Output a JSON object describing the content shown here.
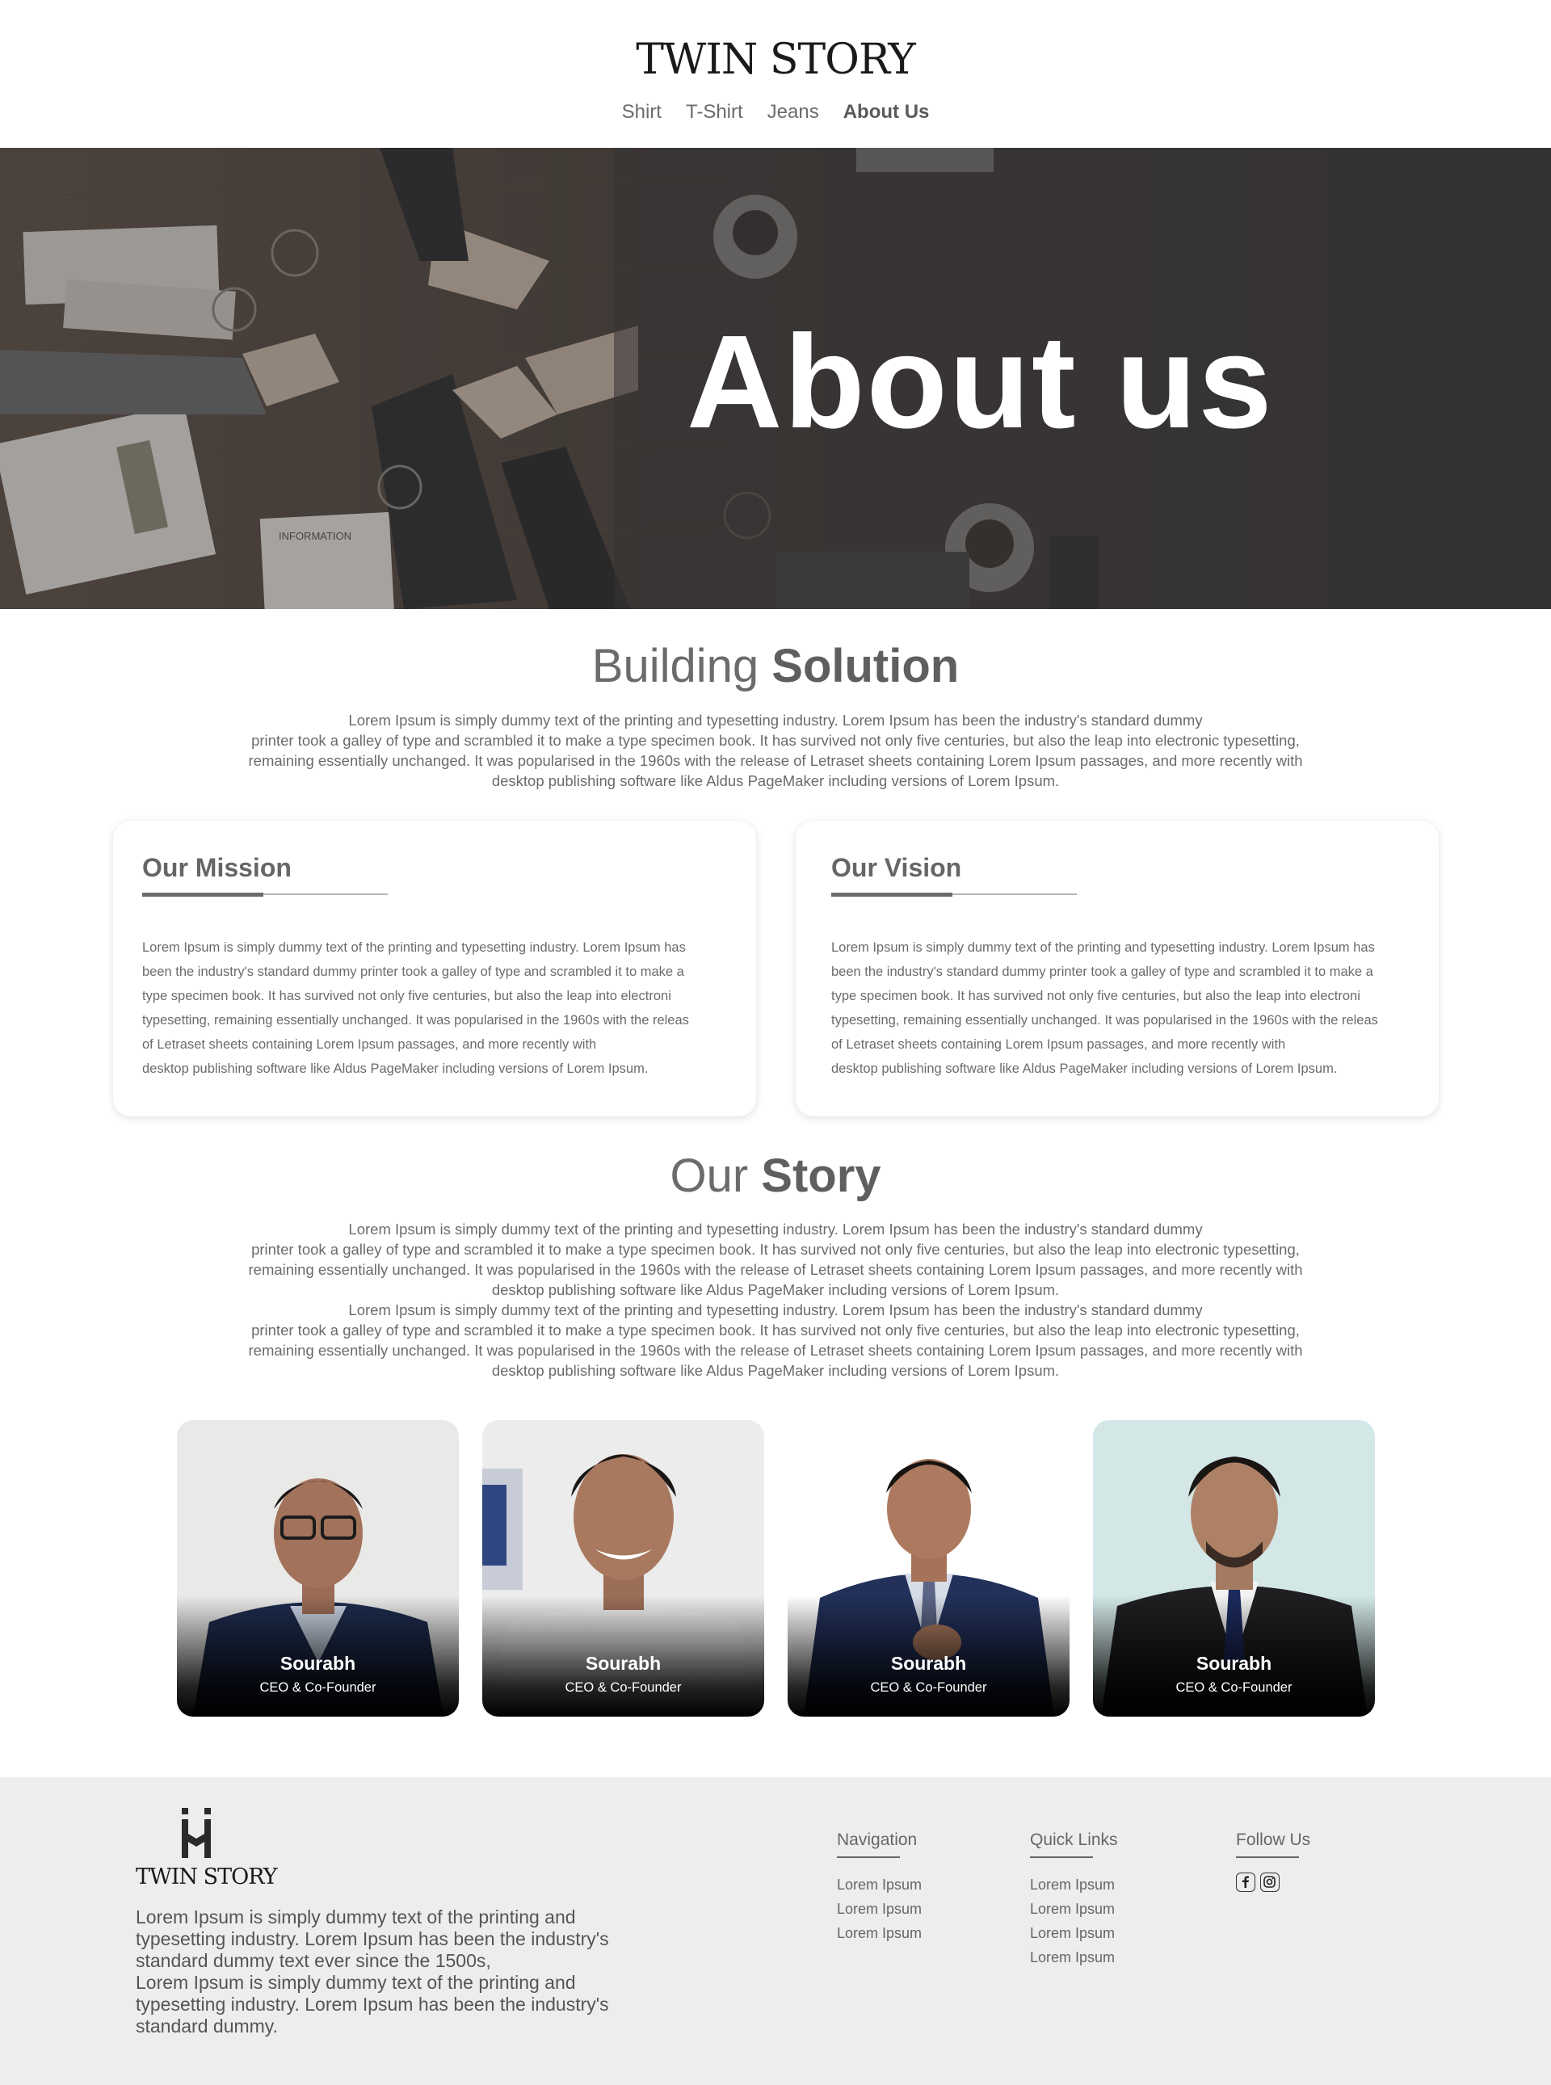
{
  "header": {
    "logo": "TWIN STORY",
    "nav": [
      {
        "label": "Shirt"
      },
      {
        "label": "T-Shirt"
      },
      {
        "label": "Jeans"
      },
      {
        "label": "About Us"
      }
    ]
  },
  "hero": {
    "title": "About us",
    "photo_label": "INFORMATION"
  },
  "building": {
    "title_light": "Building",
    "title_bold": "Solution",
    "lines": [
      "Lorem Ipsum is simply dummy text of the printing and typesetting industry. Lorem Ipsum has been the industry's standard dummy",
      "printer took a galley of type and scrambled it to make a type specimen book. It has survived not only five centuries, but also the leap into electronic typesetting,",
      "remaining essentially unchanged. It was popularised  in the 1960s with the release of Letraset sheets containing Lorem Ipsum passages, and more recently with",
      "desktop publishing software like Aldus PageMaker including versions of Lorem Ipsum."
    ]
  },
  "mission": {
    "title": "Our Mission",
    "lines": [
      "Lorem Ipsum is simply dummy text of the printing and typesetting industry. Lorem Ipsum has",
      "been the industry's standard dummy printer took a galley of type and scrambled it to make a",
      "type specimen book. It has survived not only five centuries, but also the leap into electroni",
      "typesetting, remaining essentially unchanged. It was popularised  in the 1960s with the releas",
      "of Letraset sheets containing Lorem Ipsum passages, and more recently with",
      "desktop publishing software like Aldus PageMaker including versions of Lorem Ipsum."
    ]
  },
  "vision": {
    "title": "Our Vision",
    "lines": [
      "Lorem Ipsum is simply dummy text of the printing and typesetting industry. Lorem Ipsum has",
      "been the industry's standard dummy printer took a galley of type and scrambled it to make a",
      "type specimen book. It has survived not only five centuries, but also the leap into electroni",
      "typesetting, remaining essentially unchanged. It was popularised  in the 1960s with the releas",
      "of Letraset sheets containing Lorem Ipsum passages, and more recently with",
      "desktop publishing software like Aldus PageMaker including versions of Lorem Ipsum."
    ]
  },
  "story": {
    "title_light": "Our",
    "title_bold": "Story",
    "lines": [
      "Lorem Ipsum is simply dummy text of the printing and typesetting industry. Lorem Ipsum has been the industry's standard dummy",
      "printer took a galley of type and scrambled it to make a type specimen book. It has survived not only five centuries, but also the leap into electronic typesetting,",
      "remaining essentially unchanged. It was popularised  in the 1960s with the release of Letraset sheets containing Lorem Ipsum passages, and more recently with",
      "desktop publishing software like Aldus PageMaker including versions of Lorem Ipsum.",
      "Lorem Ipsum is simply dummy text of the printing and typesetting industry. Lorem Ipsum has been the industry's standard dummy",
      "printer took a galley of type and scrambled it to make a type specimen book. It has survived not only five centuries, but also the leap into electronic typesetting,",
      "remaining essentially unchanged. It was popularised  in the 1960s with the release of Letraset sheets containing Lorem Ipsum passages, and more recently with",
      "desktop publishing software like Aldus PageMaker including versions of Lorem Ipsum."
    ]
  },
  "team": [
    {
      "name": "Sourabh",
      "role": "CEO & Co-Founder"
    },
    {
      "name": "Sourabh",
      "role": "CEO & Co-Founder"
    },
    {
      "name": "Sourabh",
      "role": "CEO & Co-Founder"
    },
    {
      "name": "Sourabh",
      "role": "CEO & Co-Founder"
    }
  ],
  "footer": {
    "logo": "TWIN STORY",
    "description": [
      "Lorem Ipsum is simply dummy text of the printing and",
      "typesetting industry. Lorem Ipsum has been the industry's",
      "standard dummy text ever since the 1500s,",
      "Lorem Ipsum is simply dummy text of the printing and",
      "typesetting industry. Lorem Ipsum has been the industry's",
      "standard dummy."
    ],
    "navigation": {
      "title": "Navigation",
      "links": [
        "Lorem Ipsum",
        "Lorem Ipsum",
        "Lorem Ipsum"
      ]
    },
    "quick_links": {
      "title": "Quick Links",
      "links": [
        "Lorem Ipsum",
        "Lorem Ipsum",
        "Lorem Ipsum",
        "Lorem Ipsum"
      ]
    },
    "follow": {
      "title": "Follow Us",
      "icons": [
        "facebook-icon",
        "instagram-icon"
      ]
    }
  },
  "colors": {
    "text": "#6b6b6b",
    "footer_bg": "#ededed",
    "hero_overlay": "#3c3a38"
  }
}
